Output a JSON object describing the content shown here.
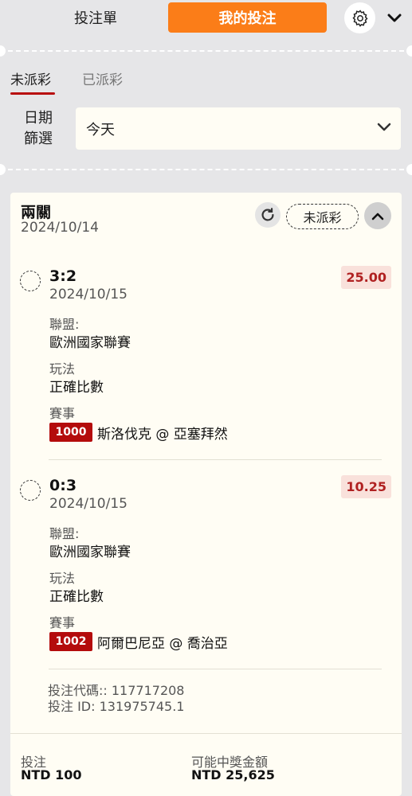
{
  "tabs": {
    "betslip": "投注單",
    "mybets": "我的投注"
  },
  "status_tabs": {
    "unsettled": "未派彩",
    "settled": "已派彩"
  },
  "date_filter": {
    "label_line1": "日期",
    "label_line2": "篩選",
    "value": "今天"
  },
  "bet": {
    "type": "兩關",
    "date": "2024/10/14",
    "status": "未派彩",
    "selections": [
      {
        "score": "3:2",
        "date": "2024/10/15",
        "odds": "25.00",
        "league_label": "聯盟:",
        "league": "歐洲國家聯賽",
        "market_label": "玩法",
        "market": "正確比數",
        "event_label": "賽事",
        "match_no": "1000",
        "match": "斯洛伐克 @ 亞塞拜然"
      },
      {
        "score": "0:3",
        "date": "2024/10/15",
        "odds": "10.25",
        "league_label": "聯盟:",
        "league": "歐洲國家聯賽",
        "market_label": "玩法",
        "market": "正確比數",
        "event_label": "賽事",
        "match_no": "1002",
        "match": "阿爾巴尼亞 @ 喬治亞"
      }
    ],
    "bet_code": "投注代碼:: 117717208",
    "bet_id": "投注 ID: 131975745.1",
    "stake_label": "投注",
    "stake_value": "NTD 100",
    "payout_label": "可能中獎金額",
    "payout_value": "NTD 25,625"
  },
  "colors": {
    "accent": "#fb7d18",
    "brand_red": "#b40c0c",
    "card_bg": "#fffdf4",
    "page_bg": "#e6e6e8"
  },
  "icons": {
    "settings": "gear-icon",
    "expand": "chevron-down-icon",
    "refresh": "refresh-icon",
    "collapse": "chevron-up-icon"
  }
}
